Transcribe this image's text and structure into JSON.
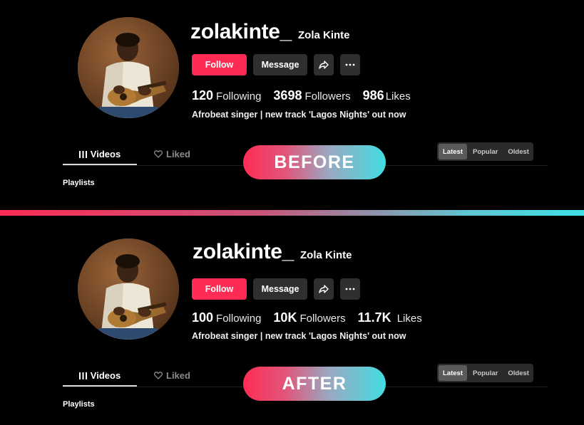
{
  "panels": [
    {
      "label": "BEFORE",
      "username": "zolakinte_",
      "display_name": "Zola Kinte",
      "buttons": {
        "follow": "Follow",
        "message": "Message"
      },
      "stats": {
        "following_count": "120",
        "following_label": "Following",
        "followers_count": "3698",
        "followers_label": "Followers",
        "likes_count": "986",
        "likes_label": "Likes"
      },
      "bio": "Afrobeat singer | new track 'Lagos Nights' out now",
      "tabs": {
        "videos": "Videos",
        "liked": "Liked"
      },
      "playlists": "Playlists",
      "sort": {
        "options": [
          "Latest",
          "Popular",
          "Oldest"
        ],
        "selected": "Latest"
      }
    },
    {
      "label": "AFTER",
      "username": "zolakinte_",
      "display_name": "Zola Kinte",
      "buttons": {
        "follow": "Follow",
        "message": "Message"
      },
      "stats": {
        "following_count": "100",
        "following_label": "Following",
        "followers_count": "10K",
        "followers_label": "Followers",
        "likes_count": "11.7K",
        "likes_label": "Likes"
      },
      "bio": "Afrobeat singer | new track 'Lagos Nights' out now",
      "tabs": {
        "videos": "Videos",
        "liked": "Liked"
      },
      "playlists": "Playlists",
      "sort": {
        "options": [
          "Latest",
          "Popular",
          "Oldest"
        ],
        "selected": "Latest"
      }
    }
  ],
  "icons": {
    "share": "share-arrow-icon",
    "more": "more-dots-icon",
    "videos_tab": "grid-bars-icon",
    "liked_tab": "heart-outline-icon"
  },
  "colors": {
    "accent": "#fe2c55",
    "accent_secondary": "#3fe0e6",
    "background": "#000000",
    "button_dark": "#2f2f2f"
  }
}
